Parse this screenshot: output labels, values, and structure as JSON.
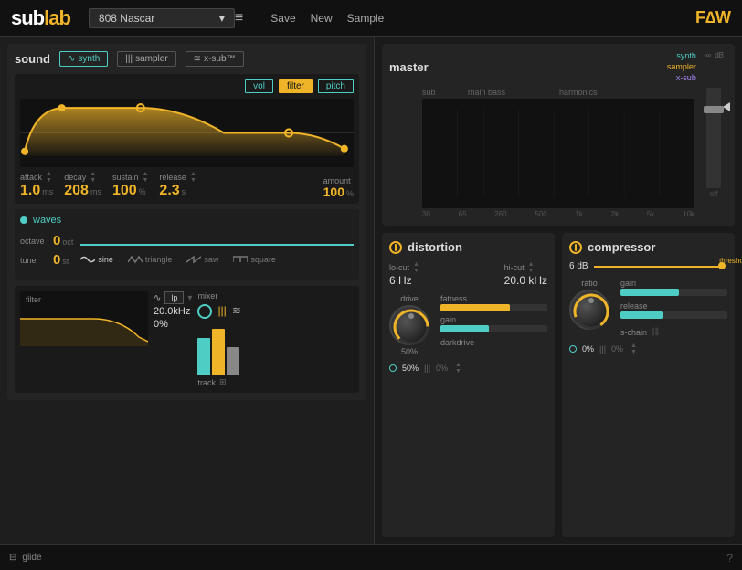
{
  "app": {
    "name_prefix": "sub",
    "name_suffix": "lab",
    "preset": "808 Nascar",
    "menu": {
      "hamburger": "≡",
      "save": "Save",
      "new": "New",
      "sample": "Sample"
    },
    "faw": "F∆W"
  },
  "sound": {
    "title": "sound",
    "tabs": {
      "synth": "synth",
      "sampler": "sampler",
      "xsub": "x-sub™"
    },
    "adsr": {
      "vol_label": "vol",
      "filter_label": "filter",
      "pitch_label": "pitch",
      "attack": {
        "label": "attack",
        "value": "1.0",
        "unit": "ms"
      },
      "decay": {
        "label": "decay",
        "value": "208",
        "unit": "ms"
      },
      "sustain": {
        "label": "sustain",
        "value": "100",
        "unit": "%"
      },
      "release": {
        "label": "release",
        "value": "2.3",
        "unit": "s"
      },
      "amount": {
        "label": "amount",
        "value": "100",
        "unit": "%"
      }
    },
    "waves": {
      "title": "waves",
      "octave": {
        "label": "octave",
        "value": "0",
        "unit": "oct"
      },
      "tune": {
        "label": "tune",
        "value": "0",
        "unit": "st"
      },
      "shapes": {
        "sine": "sine",
        "triangle": "triangle",
        "saw": "saw",
        "square": "square"
      }
    },
    "filter": {
      "label": "filter",
      "type": "lp",
      "freq": "20.0kHz",
      "res": "0%"
    },
    "mixer": {
      "label": "mixer",
      "track": "track"
    }
  },
  "master": {
    "title": "master",
    "sections": {
      "sub": "sub",
      "main_bass": "main bass",
      "harmonics": "harmonics"
    },
    "labels": {
      "synth": "synth",
      "sampler": "sampler",
      "xsub": "x-sub"
    },
    "freq_labels": [
      "30",
      "65",
      "260",
      "500",
      "1k",
      "2k",
      "5k",
      "10k"
    ],
    "db_labels": [
      "-∞",
      "dB"
    ],
    "fader_off": "off"
  },
  "distortion": {
    "title": "distortion",
    "lo_cut": {
      "label": "lo-cut",
      "value": "6 Hz"
    },
    "hi_cut": {
      "label": "hi-cut",
      "value": "20.0 kHz"
    },
    "drive": {
      "label": "drive",
      "value": "50%",
      "angle": 180
    },
    "fatness": {
      "label": "fatness",
      "fill": 65
    },
    "gain_label": "gain",
    "gain_fill": 45,
    "darkdrive": "darkdrive",
    "footer": {
      "power_value": "50%",
      "pipe_label": "0%"
    }
  },
  "compressor": {
    "title": "compressor",
    "threshold": {
      "label": "6 dB",
      "knob_label": "threshold"
    },
    "ratio": {
      "label": "ratio",
      "angle": 200
    },
    "gain": {
      "label": "gain",
      "fill": 55
    },
    "release_label": "release",
    "release_fill": 40,
    "s_chain": "s-chain",
    "footer": {
      "power_value": "0%",
      "pipe_label": "0%"
    }
  },
  "glide": {
    "label": "glide"
  },
  "icons": {
    "sine_wave": "∿",
    "triangle_wave": "⋀",
    "saw_wave": "⋇",
    "square_wave": "⊓",
    "wave_icon": "≋",
    "sampler_icon": "|||·",
    "xsub_icon": "≈",
    "power_icon": "⏻",
    "glide_bars": "⊟"
  }
}
